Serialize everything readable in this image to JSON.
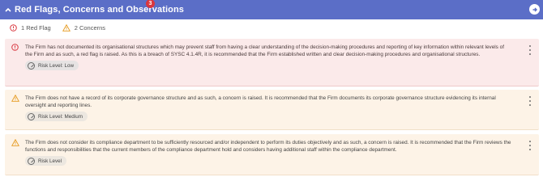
{
  "header": {
    "title": "Red Flags, Concerns and Observations",
    "badge_count": "3",
    "colors": {
      "bar": "#5b6ec7",
      "badge": "#d9363e"
    }
  },
  "summary": {
    "red_flags_label": "1 Red Flag",
    "concerns_label": "2 Concerns"
  },
  "items": [
    {
      "type": "red-flag",
      "text": "The Firm has not documented its organisational structures which may prevent staff from having a clear understanding of the decision-making procedures and reporting of key information within relevant levels of the Firm and as such, a red flag is raised. As this is a breach of SYSC 4.1.4R, it is recommended that the Firm established written and clear decision-making procedures and organisational structures.",
      "risk_label": "Risk Level: Low"
    },
    {
      "type": "concern",
      "text": "The Firm does not have a record of its corporate governance structure and as such, a concern is raised. It is recommended that the Firm documents its corporate governance structure evidencing its internal oversight and reporting lines.",
      "risk_label": "Risk Level: Medium"
    },
    {
      "type": "concern",
      "text": "The Firm does not consider its compliance department to be sufficiently resourced and/or independent to perform its duties objectively and as such, a concern is raised. It is recommended that the Firm reviews the functions and responsibilities that the current members of the compliance department hold and considers having additional staff within the compliance department.",
      "risk_label": "Risk Level"
    }
  ]
}
